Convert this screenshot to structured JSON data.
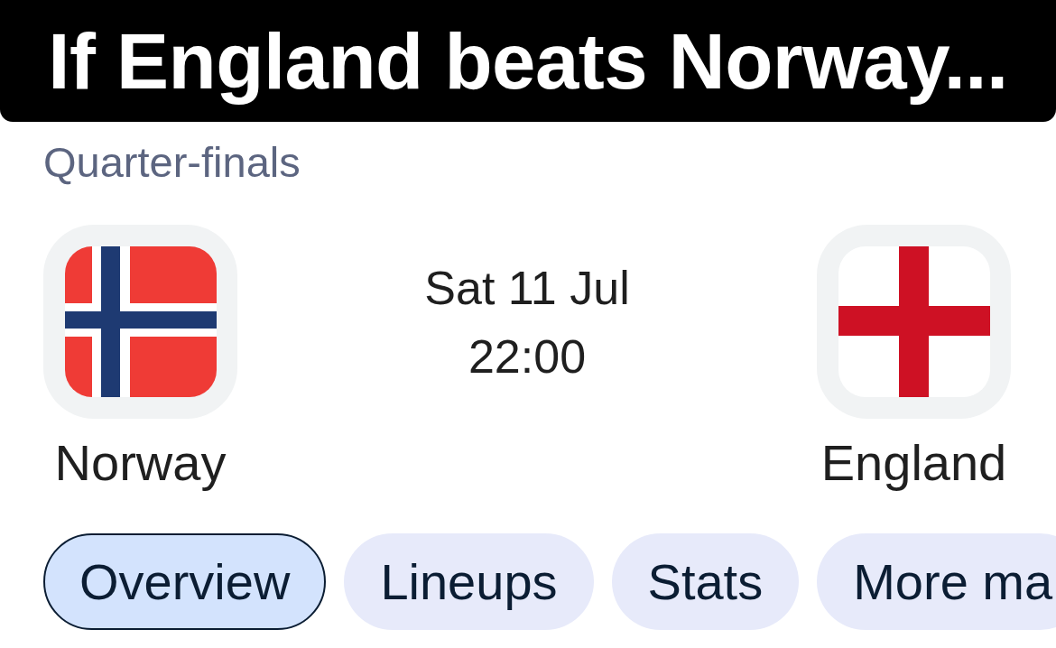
{
  "caption": "If England beats Norway...",
  "match": {
    "stage": "Quarter-finals",
    "home": {
      "name": "Norway"
    },
    "date": "Sat 11 Jul",
    "time": "22:00",
    "away": {
      "name": "England"
    }
  },
  "tabs": [
    {
      "label": "Overview",
      "selected": true
    },
    {
      "label": "Lineups",
      "selected": false
    },
    {
      "label": "Stats",
      "selected": false
    },
    {
      "label": "More ma",
      "selected": false
    }
  ]
}
